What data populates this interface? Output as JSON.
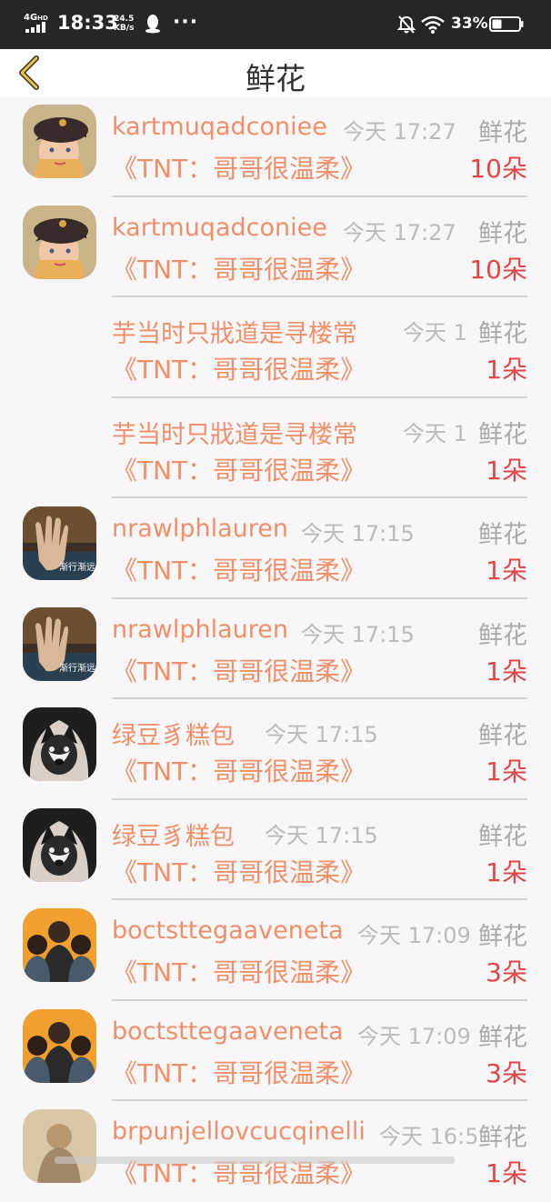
{
  "status_bar": {
    "network": "4G",
    "network_sup": "HD",
    "time": "18:33",
    "speed_value": "24.5",
    "speed_unit": "KB/s",
    "more": "···",
    "battery": "33%",
    "icons": [
      "signal-icon",
      "qq-icon",
      "mute-icon",
      "wifi-icon",
      "battery-icon"
    ]
  },
  "header": {
    "title": "鲜花",
    "back_icon": "chevron-left-icon",
    "accent": "#f0b43c"
  },
  "colors": {
    "name": "#f0906a",
    "time": "#bbbbbb",
    "gift_type": "#aaaaaa",
    "count": "#e04848",
    "divider": "#d4d4d4"
  },
  "rows": [
    {
      "name": "kartmuqadconiee",
      "time": "今天 17:27",
      "gift_type": "鲜花",
      "song": "《TNT：哥哥很温柔》",
      "count": "10朵",
      "avatar": "girl-with-cap"
    },
    {
      "name": "kartmuqadconiee",
      "time": "今天 17:27",
      "gift_type": "鲜花",
      "song": "《TNT：哥哥很温柔》",
      "count": "10朵",
      "avatar": "girl-with-cap"
    },
    {
      "name": "芋当时只戕道是寻楼常",
      "time": "今天 1",
      "gift_type": "鲜花",
      "song": "《TNT：哥哥很温柔》",
      "count": "1朵",
      "avatar": ""
    },
    {
      "name": "芋当时只戕道是寻楼常",
      "time": "今天 1",
      "gift_type": "鲜花",
      "song": "《TNT：哥哥很温柔》",
      "count": "1朵",
      "avatar": ""
    },
    {
      "name": "nrawlphlauren",
      "time": "今天 17:15",
      "gift_type": "鲜花",
      "song": "《TNT：哥哥很温柔》",
      "count": "1朵",
      "avatar": "hand",
      "avatar_text": "渐行渐远"
    },
    {
      "name": "nrawlphlauren",
      "time": "今天 17:15",
      "gift_type": "鲜花",
      "song": "《TNT：哥哥很温柔》",
      "count": "1朵",
      "avatar": "hand",
      "avatar_text": "渐行渐远"
    },
    {
      "name": "绿豆豸糕包",
      "time": "今天 17:15",
      "gift_type": "鲜花",
      "song": "《TNT：哥哥很温柔》",
      "count": "1朵",
      "avatar": "husky"
    },
    {
      "name": "绿豆豸糕包",
      "time": "今天 17:15",
      "gift_type": "鲜花",
      "song": "《TNT：哥哥很温柔》",
      "count": "1朵",
      "avatar": "husky"
    },
    {
      "name": "boctsttegaaveneta",
      "time": "今天 17:09",
      "gift_type": "鲜花",
      "song": "《TNT：哥哥很温柔》",
      "count": "3朵",
      "avatar": "group"
    },
    {
      "name": "boctsttegaaveneta",
      "time": "今天 17:09",
      "gift_type": "鲜花",
      "song": "《TNT：哥哥很温柔》",
      "count": "3朵",
      "avatar": "group"
    },
    {
      "name": "brpunjellovcucqinelli",
      "time": "今天 16:5",
      "gift_type": "鲜花",
      "song": "《TNT：哥哥很温柔》",
      "count": "1朵",
      "avatar": "sketch"
    }
  ]
}
